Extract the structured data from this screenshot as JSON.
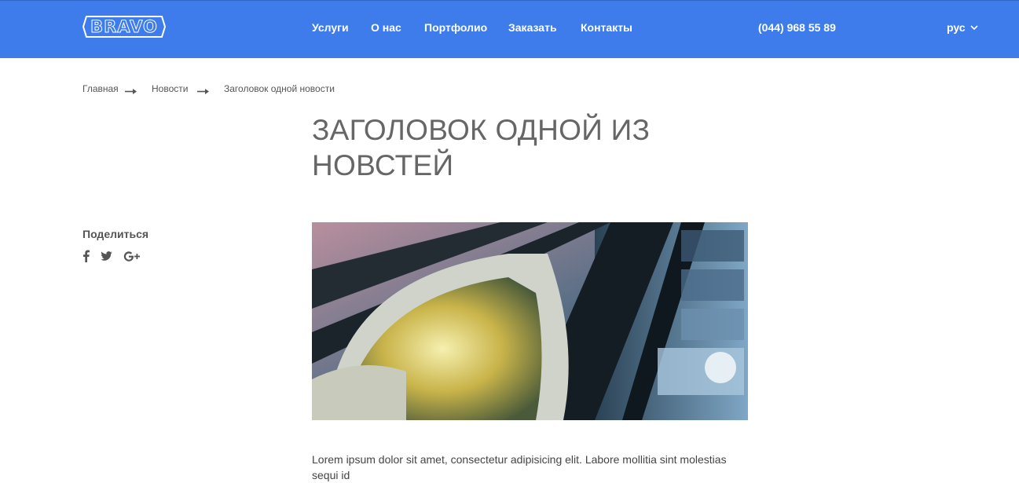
{
  "header": {
    "logo_text": "BRAVO",
    "nav": [
      {
        "label": "Услуги"
      },
      {
        "label": "О нас"
      },
      {
        "label": "Портфолио"
      },
      {
        "label": "Заказать"
      },
      {
        "label": "Контакты"
      }
    ],
    "phone": "(044) 968 55 89",
    "language": "рус",
    "background_color": "#3e7cec"
  },
  "breadcrumb": {
    "items": [
      "Главная",
      "Новости",
      "Заголовок одной новости"
    ]
  },
  "article": {
    "title": "Заголовок одной из новстей",
    "body": "Lorem ipsum dolor sit amet, consectetur adipisicing elit. Labore mollitia sint molestias sequi id"
  },
  "share": {
    "label": "Поделиться",
    "icons": [
      "facebook-icon",
      "twitter-icon",
      "google-plus-icon"
    ]
  }
}
